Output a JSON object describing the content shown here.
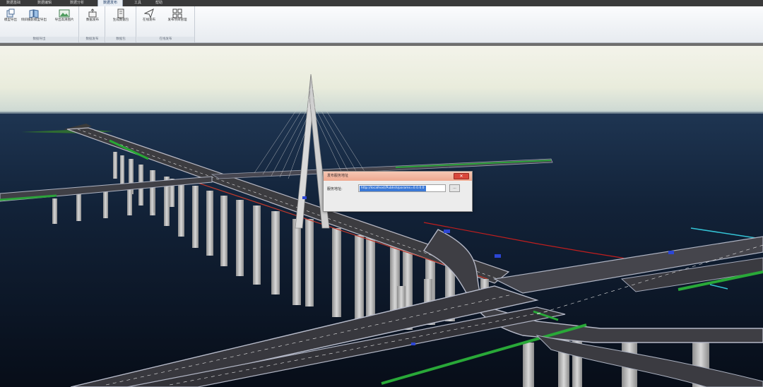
{
  "tabs": [
    {
      "label": "数据基础"
    },
    {
      "label": "数据编辑"
    },
    {
      "label": "数据分析"
    },
    {
      "label": "数据发布"
    },
    {
      "label": "工具"
    },
    {
      "label": "帮助"
    }
  ],
  "active_tab": "数据发布",
  "ribbon": {
    "groups": [
      {
        "label": "数据导出",
        "buttons": [
          {
            "label": "模型导出",
            "icon": "model-export-icon"
          },
          {
            "label": "倾斜摄影模型导出",
            "icon": "oblique-photo-export-icon"
          },
          {
            "label": "导出高清图片",
            "icon": "export-image-icon"
          }
        ]
      },
      {
        "label": "数据发布",
        "buttons": [
          {
            "label": "数据发布",
            "icon": "data-publish-icon"
          }
        ]
      },
      {
        "label": "数据包",
        "buttons": [
          {
            "label": "生成数据包",
            "icon": "data-package-icon"
          }
        ]
      },
      {
        "label": "在线发布",
        "buttons": [
          {
            "label": "在线发布",
            "icon": "send-icon"
          },
          {
            "label": "发布项目管理",
            "icon": "grid-icon"
          }
        ]
      }
    ]
  },
  "dialog": {
    "title": "发布服务地址",
    "close_label": "✕",
    "field_label": "服务地址:",
    "field_value": "http://localhost/Publish/params=0.0.0.0",
    "browse_label": "..."
  },
  "colors": {
    "sky_top": "#eef0e4",
    "sea": "#0d1a2c",
    "dialog_title": "#eea88f",
    "selection": "#3a78d6"
  }
}
